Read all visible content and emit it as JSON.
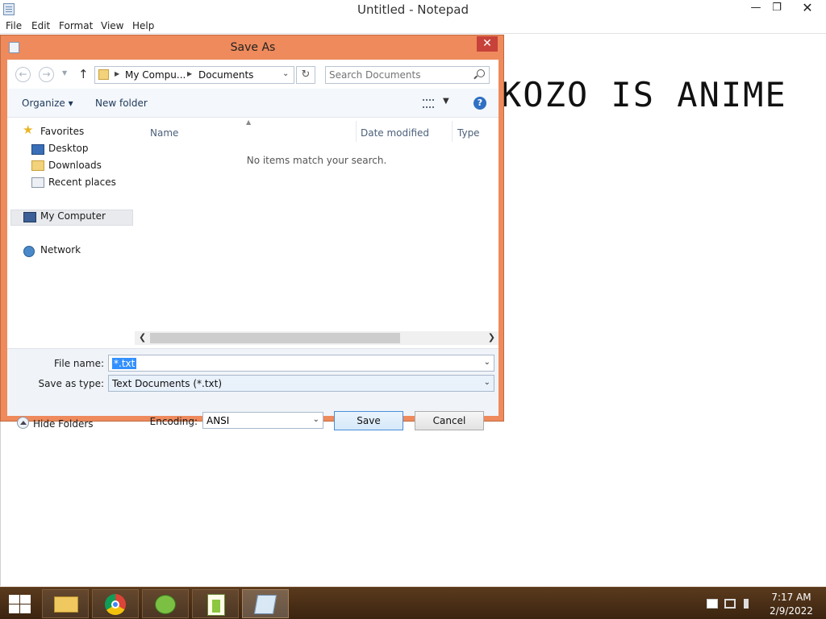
{
  "notepad": {
    "title": "Untitled - Notepad",
    "menu": [
      "File",
      "Edit",
      "Format",
      "View",
      "Help"
    ],
    "editor_text": "KOZO IS ANIME"
  },
  "dialog": {
    "title": "Save As",
    "breadcrumb": [
      "My Compu...",
      "Documents"
    ],
    "search_placeholder": "Search Documents",
    "toolbar": {
      "organize": "Organize",
      "new_folder": "New folder"
    },
    "nav": {
      "favorites": "Favorites",
      "desktop": "Desktop",
      "downloads": "Downloads",
      "recent_places": "Recent places",
      "my_computer": "My Computer",
      "network": "Network"
    },
    "columns": [
      "Name",
      "Date modified",
      "Type"
    ],
    "empty_message": "No items match your search.",
    "file_name_label": "File name:",
    "file_name_value": "*.txt",
    "save_type_label": "Save as type:",
    "save_type_value": "Text Documents (*.txt)",
    "hide_folders": "Hide Folders",
    "encoding_label": "Encoding:",
    "encoding_value": "ANSI",
    "save_button": "Save",
    "cancel_button": "Cancel"
  },
  "taskbar": {
    "apps": [
      "file-explorer",
      "chrome",
      "notepad-plus-plus-frog",
      "notepad-plus-plus",
      "notepad"
    ],
    "clock_time": "7:17 AM",
    "clock_date": "2/9/2022"
  },
  "colors": {
    "dialog_frame": "#ee8a5c",
    "close_red": "#c7423a",
    "selection_blue": "#3390ff",
    "taskbar": "#4a2f16"
  }
}
